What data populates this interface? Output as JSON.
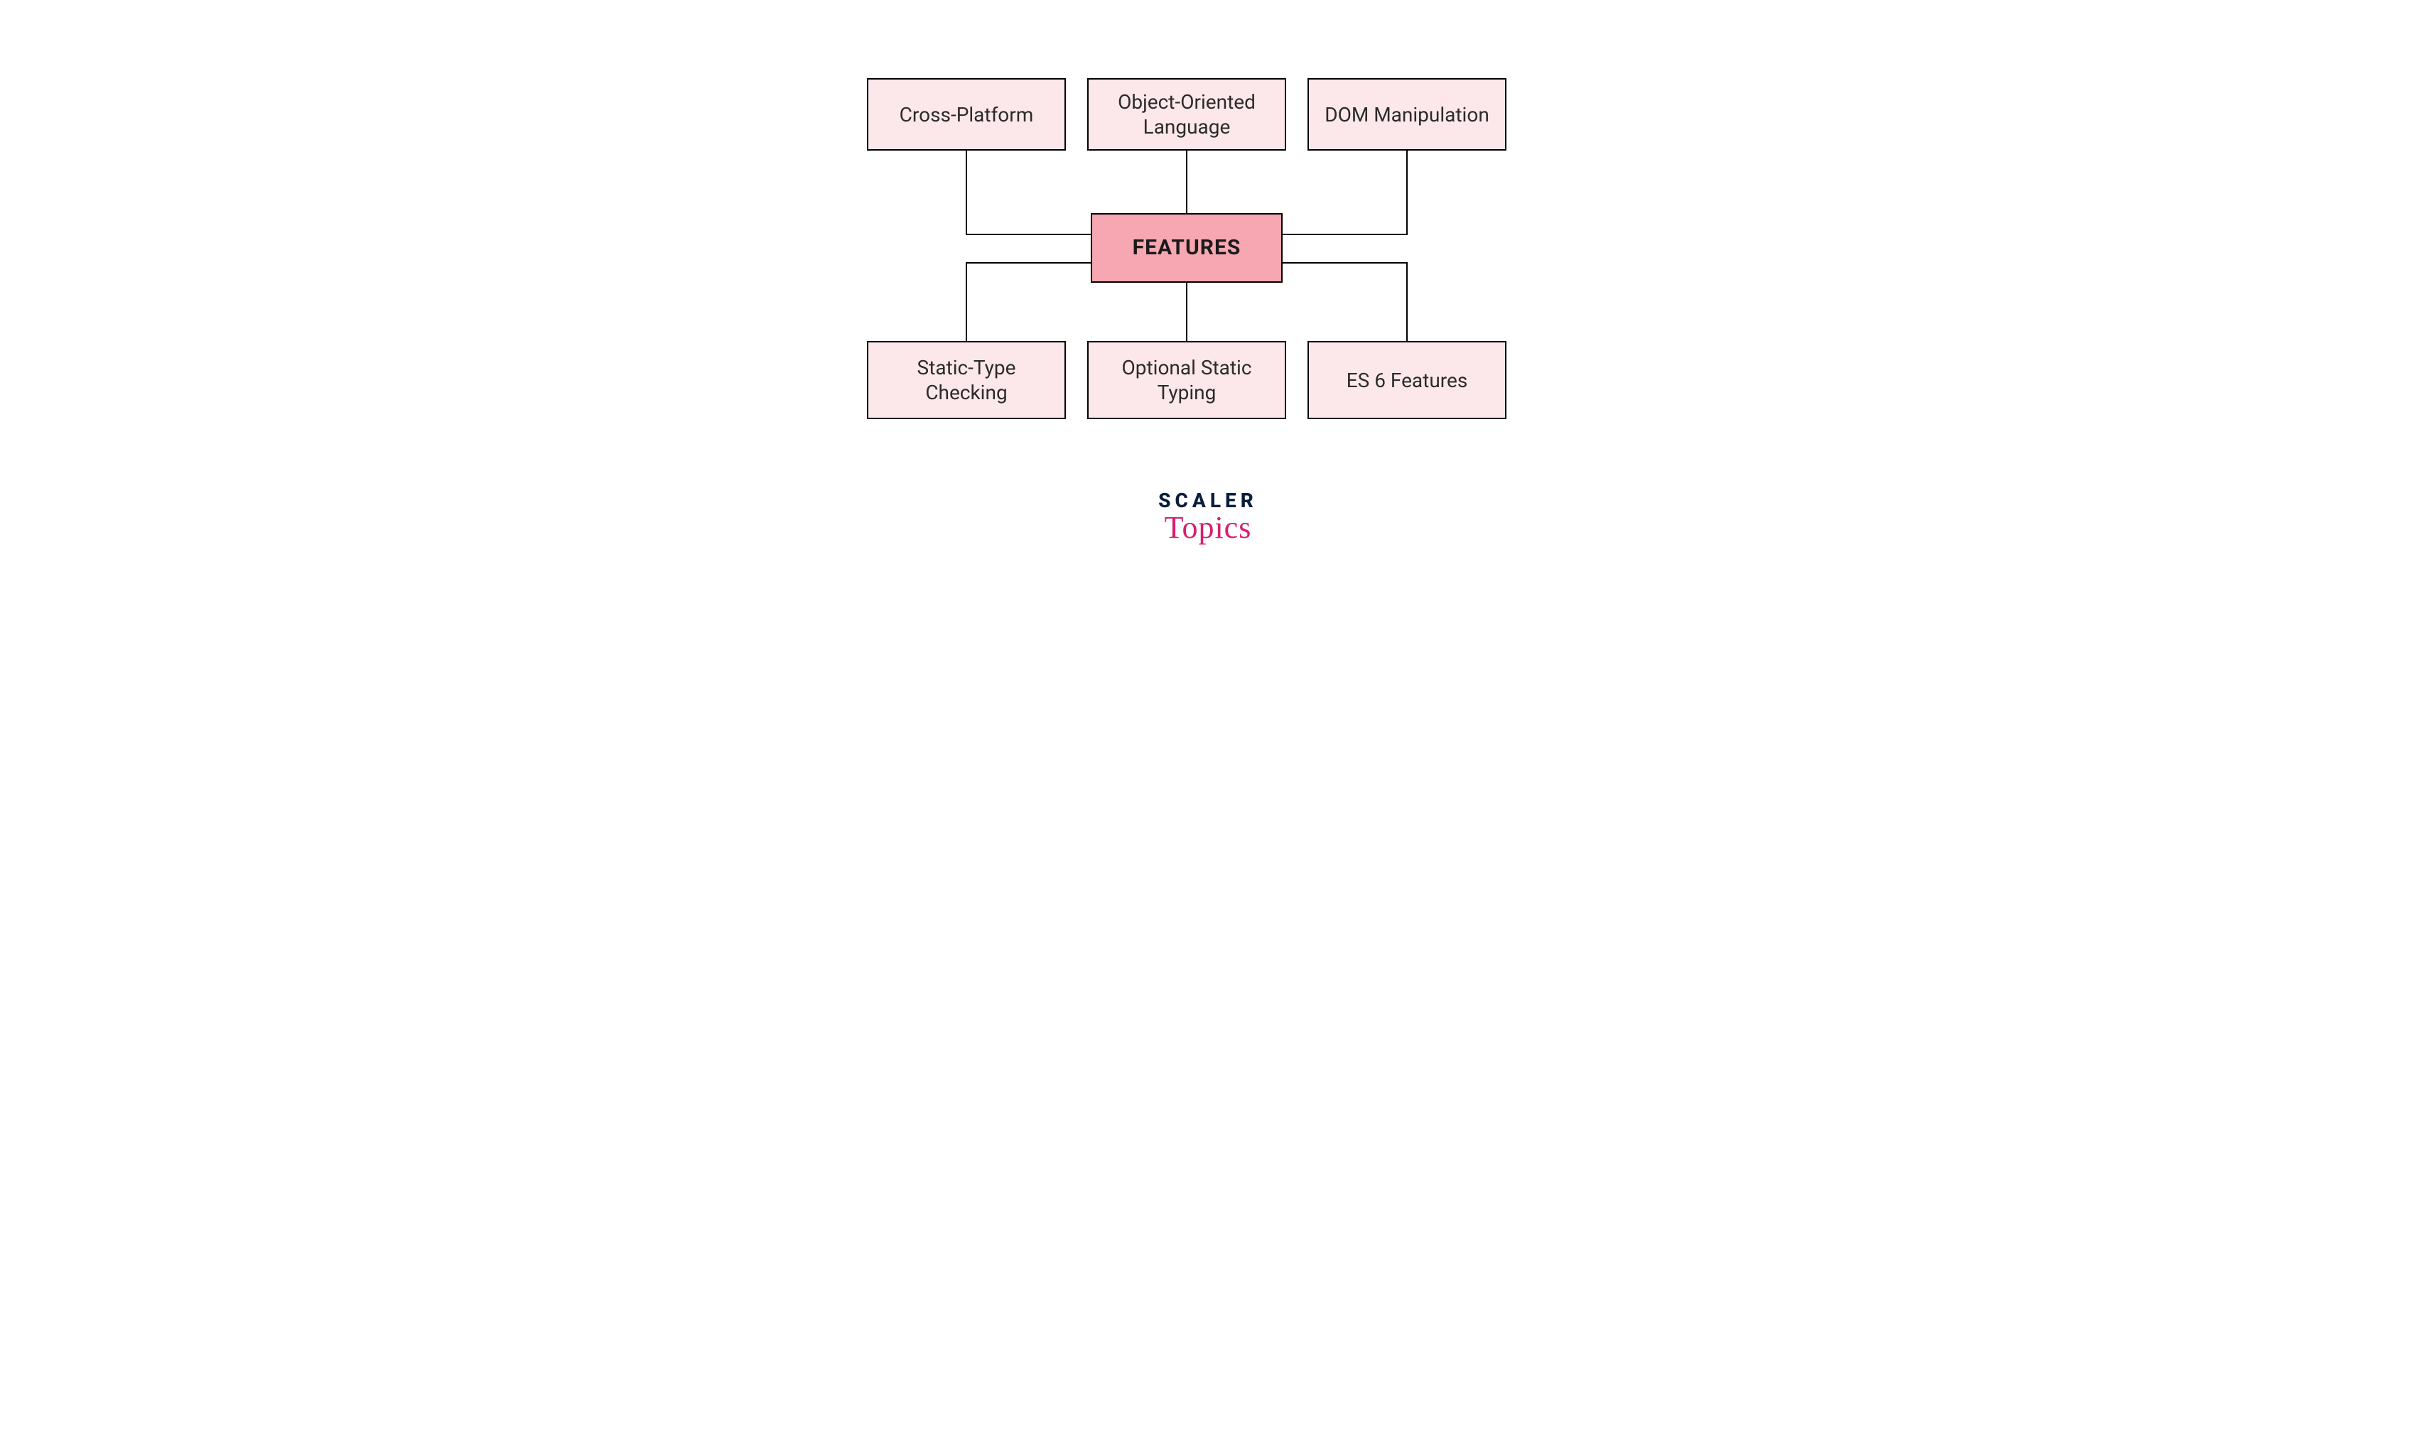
{
  "diagram": {
    "center": {
      "label": "FEATURES"
    },
    "top": [
      {
        "label": "Cross-Platform"
      },
      {
        "label": "Object-Oriented Language"
      },
      {
        "label": "DOM Manipulation"
      }
    ],
    "bottom": [
      {
        "label": "Static-Type Checking"
      },
      {
        "label": "Optional Static Typing"
      },
      {
        "label": "ES 6 Features"
      }
    ]
  },
  "logo": {
    "line1": "SCALER",
    "line2": "Topics"
  },
  "colors": {
    "nodeFill": "#fce8eb",
    "centerFill": "#f6a7b1",
    "border": "#000000",
    "logoDark": "#0a1e3c",
    "logoPink": "#d81e6f"
  }
}
